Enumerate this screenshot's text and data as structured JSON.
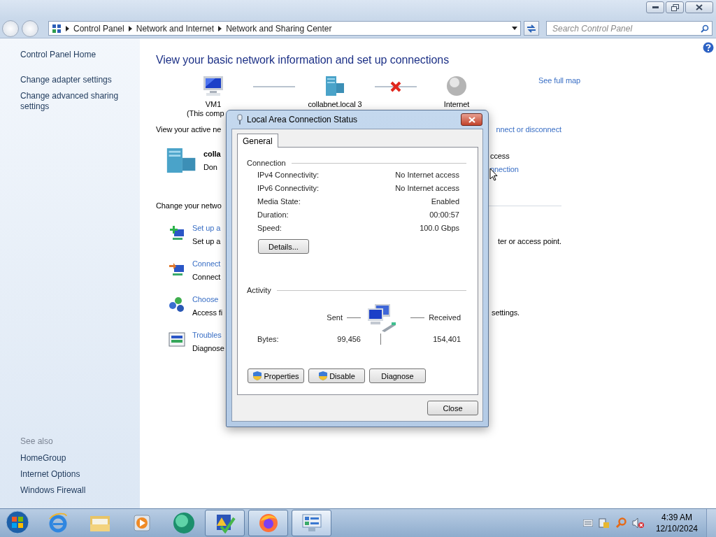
{
  "window": {
    "breadcrumbs": [
      "Control Panel",
      "Network and Internet",
      "Network and Sharing Center"
    ],
    "search": {
      "placeholder": "Search Control Panel"
    }
  },
  "sidebar": {
    "links": [
      "Control Panel Home",
      "Change adapter settings",
      "Change advanced sharing settings"
    ],
    "see_also_title": "See also",
    "see_also": [
      "HomeGroup",
      "Internet Options",
      "Windows Firewall"
    ]
  },
  "main": {
    "title": "View your basic network information and set up connections",
    "map": {
      "nodes": [
        {
          "kind": "computer",
          "label": "VM1",
          "sublabel": "(This comp"
        },
        {
          "kind": "domain",
          "label": "collabnet.local  3"
        },
        {
          "kind": "internet",
          "label": "Internet"
        }
      ],
      "links": [
        {
          "broken": false
        },
        {
          "broken": true
        }
      ],
      "full_map_link": "See full map"
    },
    "active": {
      "heading": "View your active ne",
      "action_link": "nnect or disconnect",
      "network_name": "colla",
      "network_type": "Don",
      "access": "ccess",
      "connection_link": "nnection"
    },
    "change": {
      "heading": "Change your netwo",
      "tasks": [
        {
          "kind": "setup",
          "title": "Set up a",
          "description": "Set up a",
          "description_end": "ter or access point."
        },
        {
          "kind": "connect",
          "title": "Connect",
          "description": "Connect"
        },
        {
          "kind": "homegroup",
          "title": "Choose",
          "description": "Access fi",
          "description_end": "settings."
        },
        {
          "kind": "troubleshoot",
          "title": "Troubles",
          "description": "Diagnose"
        }
      ]
    }
  },
  "dialog": {
    "title": "Local Area Connection Status",
    "tabs": [
      {
        "label": "General",
        "selected": true
      }
    ],
    "connection": {
      "heading": "Connection",
      "rows": [
        {
          "label": "IPv4 Connectivity:",
          "value": "No Internet access"
        },
        {
          "label": "IPv6 Connectivity:",
          "value": "No Internet access"
        },
        {
          "label": "Media State:",
          "value": "Enabled"
        },
        {
          "label": "Duration:",
          "value": "00:00:57"
        },
        {
          "label": "Speed:",
          "value": "100.0 Gbps"
        }
      ]
    },
    "details_button": "Details...",
    "activity": {
      "heading": "Activity",
      "sent_label": "Sent",
      "received_label": "Received",
      "bytes_label": "Bytes:",
      "sent": "99,456",
      "received": "154,401"
    },
    "buttons": [
      {
        "label": "Properties",
        "shield": true
      },
      {
        "label": "Disable",
        "shield": true
      },
      {
        "label": "Diagnose",
        "shield": false
      }
    ],
    "close_button": "Close"
  },
  "taskbar": {
    "apps": [
      {
        "kind": "ie",
        "running": false,
        "active": false
      },
      {
        "kind": "explorer",
        "running": false,
        "active": false
      },
      {
        "kind": "media",
        "running": false,
        "active": false
      },
      {
        "kind": "chat",
        "running": false,
        "active": false
      },
      {
        "kind": "checklist",
        "running": true,
        "active": false
      },
      {
        "kind": "firefox",
        "running": true,
        "active": false
      },
      {
        "kind": "control-panel",
        "running": true,
        "active": true
      }
    ],
    "time": "4:39 AM",
    "date": "12/10/2024"
  }
}
